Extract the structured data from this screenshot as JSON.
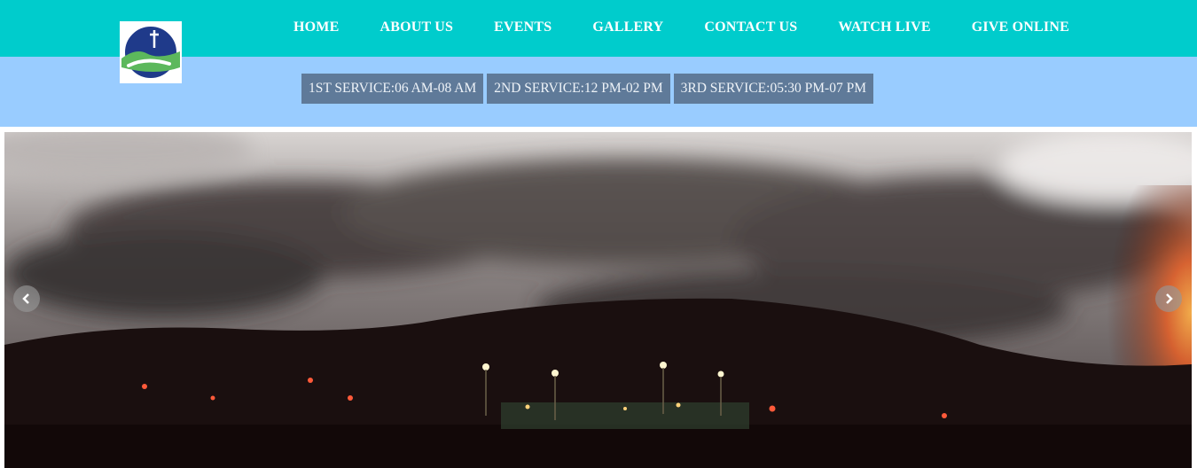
{
  "header": {
    "logo_icon": "church-cross-hill-logo-icon",
    "nav": [
      {
        "label": "HOME"
      },
      {
        "label": "ABOUT US"
      },
      {
        "label": "EVENTS"
      },
      {
        "label": "GALLERY"
      },
      {
        "label": "CONTACT US"
      },
      {
        "label": "WATCH LIVE"
      },
      {
        "label": "GIVE ONLINE"
      }
    ]
  },
  "services": [
    {
      "label": "1ST SERVICE:06 AM-08 AM"
    },
    {
      "label": "2ND SERVICE:12 PM-02 PM"
    },
    {
      "label": "3RD SERVICE:05:30 PM-07 PM"
    }
  ],
  "slider": {
    "prev_icon": "chevron-left-icon",
    "next_icon": "chevron-right-icon"
  },
  "colors": {
    "topbar": "#00cccc",
    "servicebar": "#99ccff",
    "service_badge": "#5f7a99"
  }
}
